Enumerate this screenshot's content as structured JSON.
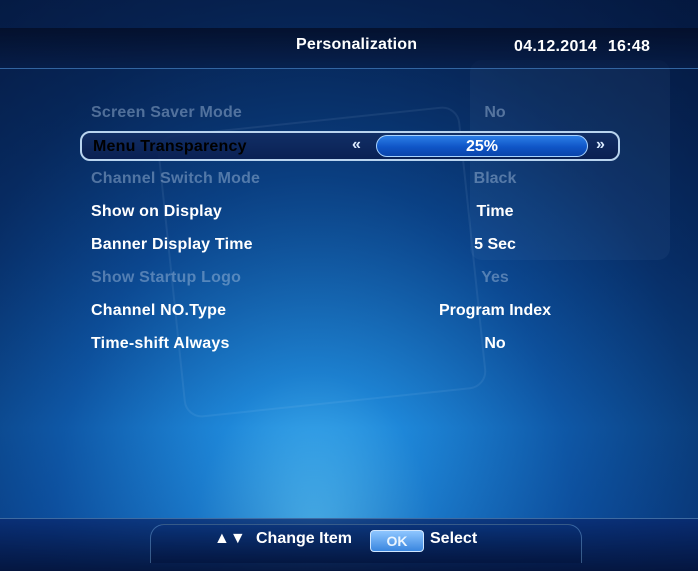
{
  "header": {
    "title": "Personalization",
    "datetime": "04.12.2014  16:48"
  },
  "settings": [
    {
      "label": "Screen Saver Mode",
      "value": "No",
      "state": "disabled"
    },
    {
      "label": "Menu Transparency",
      "value": "25%",
      "state": "selected"
    },
    {
      "label": "Channel Switch Mode",
      "value": "Black",
      "state": "disabled"
    },
    {
      "label": "Show on Display",
      "value": "Time",
      "state": "enabled"
    },
    {
      "label": "Banner Display Time",
      "value": "5 Sec",
      "state": "enabled"
    },
    {
      "label": "Show Startup Logo",
      "value": "Yes",
      "state": "disabled"
    },
    {
      "label": "Channel NO.Type",
      "value": "Program Index",
      "state": "enabled"
    },
    {
      "label": "Time-shift Always",
      "value": "No",
      "state": "enabled"
    }
  ],
  "slider": {
    "left_arrow": "«",
    "right_arrow": "»"
  },
  "footer": {
    "arrows": "▲▼",
    "change_label": "Change Item",
    "ok_label": "OK",
    "select_label": "Select"
  },
  "colors": {
    "selected_bar": "#1a6ad8",
    "accent_line": "#5aa8ff"
  }
}
